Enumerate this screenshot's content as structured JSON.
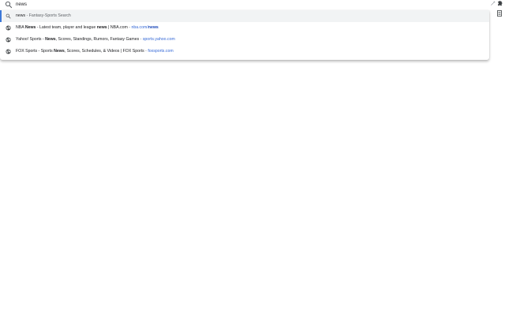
{
  "omnibox": {
    "query": "news",
    "search_icon": "search-icon"
  },
  "toolbar": {
    "star_icon": "star-icon",
    "extension_icon": "extension-icon",
    "menu_icon": "menu-icon"
  },
  "suggestions": [
    {
      "type": "search",
      "icon": "search-icon",
      "match": "news",
      "separator": " - ",
      "description": "Fantasy-Sports Search"
    },
    {
      "type": "history",
      "icon": "globe-icon",
      "title_pre": "NBA ",
      "title_bold": "News",
      "title_mid": " - Latest team, player and league ",
      "title_bold2": "news",
      "title_post": " | NBA.com",
      "separator": " - ",
      "url_pre": "nba.com/",
      "url_bold": "news"
    },
    {
      "type": "history",
      "icon": "globe-icon",
      "title_pre": "Yahoo! Sports - ",
      "title_bold": "News",
      "title_post": ", Scores, Standings, Rumors, Fantasy Games",
      "separator": " - ",
      "url": "sports.yahoo.com"
    },
    {
      "type": "history",
      "icon": "globe-icon",
      "title_pre": "FOX Sports - Sports ",
      "title_bold": "News",
      "title_post": ", Scores, Schedules, & Videos | FOX Sports",
      "separator": " - ",
      "url": "foxsports.com"
    }
  ],
  "colors": {
    "accent": "#3c78d8",
    "url": "#3367d6",
    "selected_bg": "#f1f3f4"
  }
}
